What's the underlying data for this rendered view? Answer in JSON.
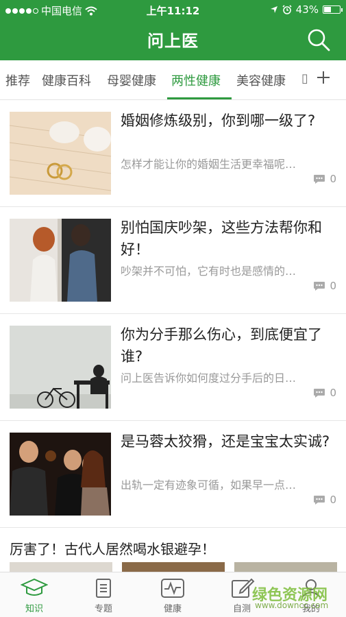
{
  "status_bar": {
    "carrier": "中国电信",
    "time": "上午11:12",
    "battery_label": "43%",
    "battery_level": 0.43,
    "signal_dots_filled": 4,
    "signal_dots_total": 5
  },
  "header": {
    "title": "问上医",
    "background_color": "#2e9a3f"
  },
  "tabs": {
    "items": [
      {
        "label": "推荐",
        "active": false
      },
      {
        "label": "健康百科",
        "active": false
      },
      {
        "label": "母婴健康",
        "active": false
      },
      {
        "label": "两性健康",
        "active": true
      },
      {
        "label": "美容健康",
        "active": false
      }
    ],
    "active_color": "#2e9a3f"
  },
  "articles": [
    {
      "title": "婚姻修炼级别，你到哪一级了?",
      "desc": "怎样才能让你的婚姻生活更幸福呢…",
      "comments": "0"
    },
    {
      "title": "别怕国庆吵架，这些方法帮你和好！",
      "desc": "吵架并不可怕，它有时也是感情的…",
      "comments": "0"
    },
    {
      "title": "你为分手那么伤心，到底便宜了谁?",
      "desc": "问上医告诉你如何度过分手后的日…",
      "comments": "0"
    },
    {
      "title": "是马蓉太狡猾，还是宝宝太实诚?",
      "desc": "出轨一定有迹象可循，如果早一点…",
      "comments": "0"
    }
  ],
  "headline": "厉害了！古代人居然喝水银避孕！",
  "bottom_nav": [
    {
      "label": "知识",
      "icon": "graduation-cap-icon",
      "active": true
    },
    {
      "label": "专题",
      "icon": "clipboard-icon",
      "active": false
    },
    {
      "label": "健康",
      "icon": "heartbeat-icon",
      "active": false
    },
    {
      "label": "自测",
      "icon": "edit-icon",
      "active": false
    },
    {
      "label": "我的",
      "icon": "user-icon",
      "active": false
    }
  ],
  "watermark": {
    "text": "绿色资源网",
    "url": "www.downcc.com"
  }
}
